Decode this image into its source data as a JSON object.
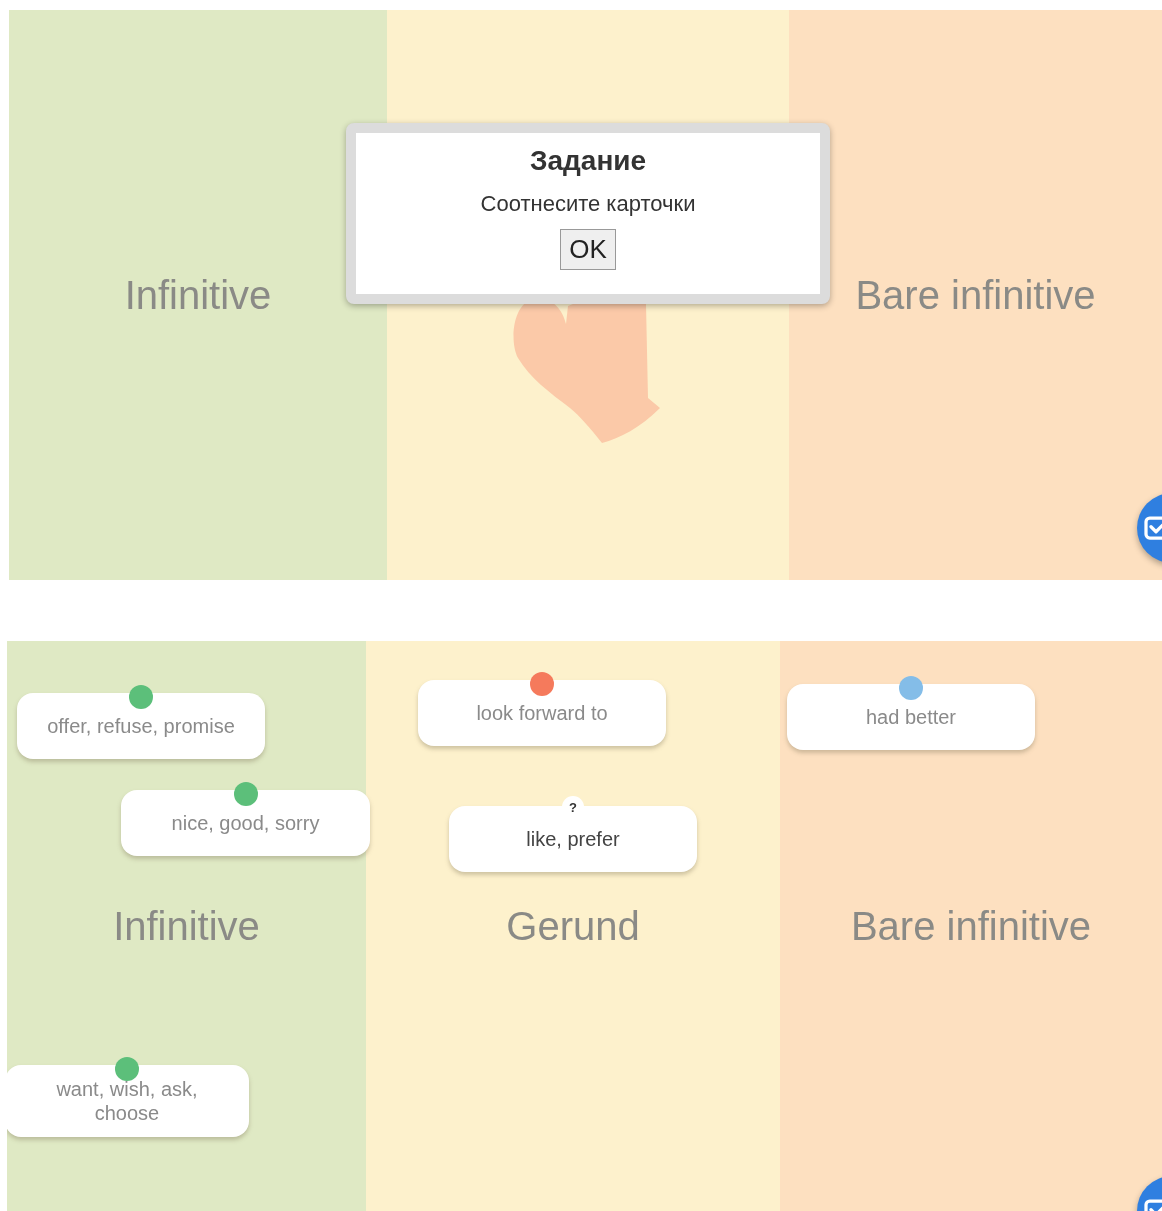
{
  "screens": [
    {
      "columns": [
        {
          "label": "Infinitive"
        },
        {},
        {
          "label": "Bare infinitive"
        }
      ],
      "hint_hand": true,
      "dialog": {
        "title": "Задание",
        "message": "Соотнесите карточки",
        "button": "OK"
      }
    },
    {
      "columns": [
        {
          "label": "Infinitive"
        },
        {
          "label": "Gerund"
        },
        {
          "label": "Bare infinitive"
        }
      ],
      "cards": [
        {
          "text": "offer, refuse, promise",
          "kind": "placed",
          "color": "#5cbf7a"
        },
        {
          "text": "nice, good, sorry",
          "kind": "placed",
          "color": "#5cbf7a"
        },
        {
          "text": "look forward to",
          "kind": "placed",
          "color": "#f57a5c"
        },
        {
          "text": "like, prefer",
          "kind": "pending",
          "badge": "?"
        },
        {
          "text": "had better",
          "kind": "placed",
          "color": "#84bde8"
        },
        {
          "text": "want, wish, ask, choose",
          "kind": "placed",
          "color": "#5cbf7a"
        }
      ],
      "hint_hand": false
    }
  ]
}
